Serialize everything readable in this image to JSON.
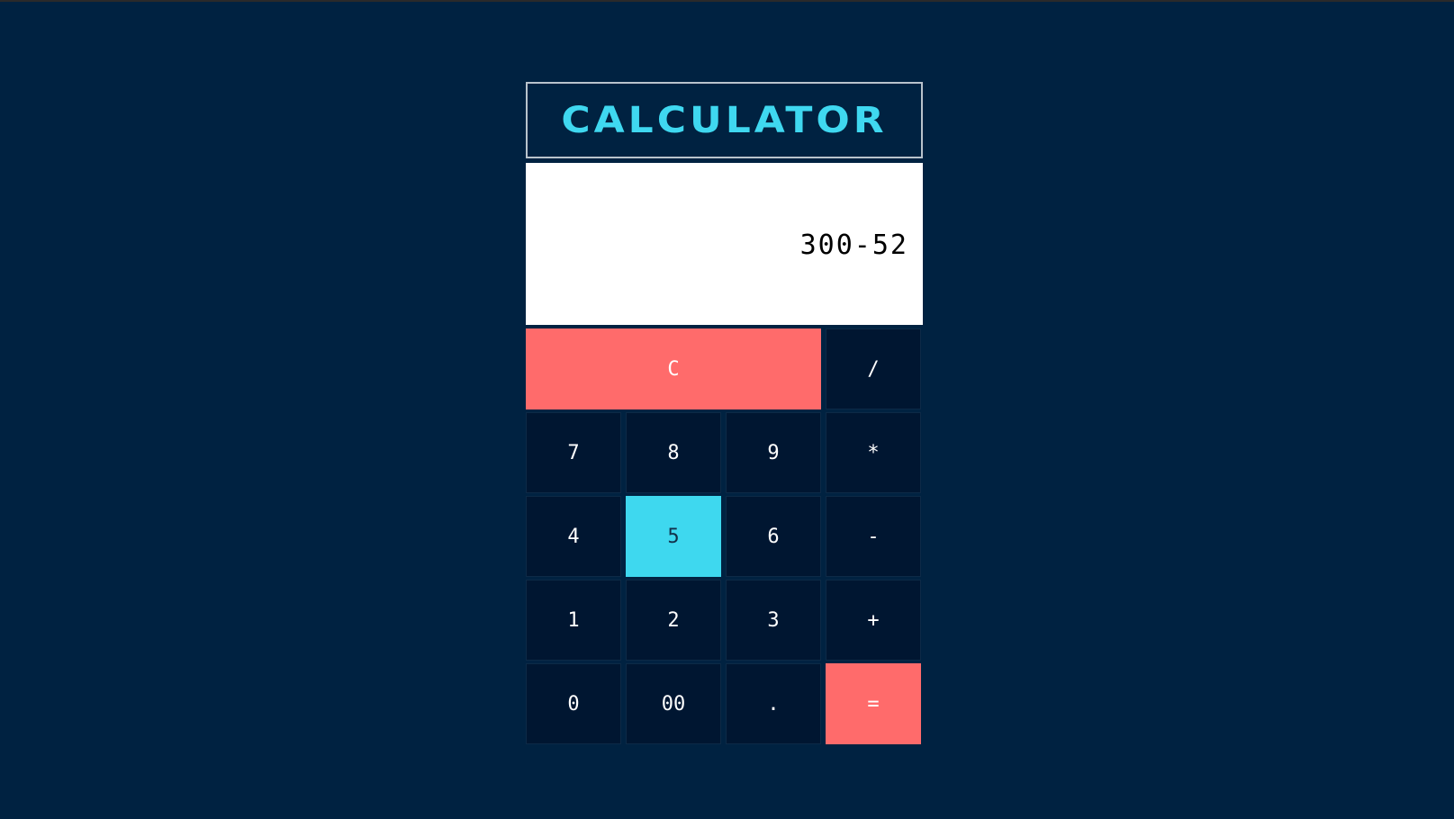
{
  "app": {
    "title": "CALCULATOR"
  },
  "display": {
    "value": "300-52"
  },
  "keys": {
    "clear": "C",
    "divide": "/",
    "seven": "7",
    "eight": "8",
    "nine": "9",
    "multiply": "*",
    "four": "4",
    "five": "5",
    "six": "6",
    "subtract": "-",
    "one": "1",
    "two": "2",
    "three": "3",
    "add": "+",
    "zero": "0",
    "double_zero": "00",
    "decimal": ".",
    "equals": "="
  },
  "state": {
    "highlighted_key": "5"
  },
  "colors": {
    "background": "#002241",
    "title_text": "#3fd8f0",
    "clear_button": "#ff6b6b",
    "equals_button": "#ff6b6b",
    "key_background": "#001631",
    "highlighted_key": "#3ed8ef",
    "display_background": "#ffffff"
  }
}
